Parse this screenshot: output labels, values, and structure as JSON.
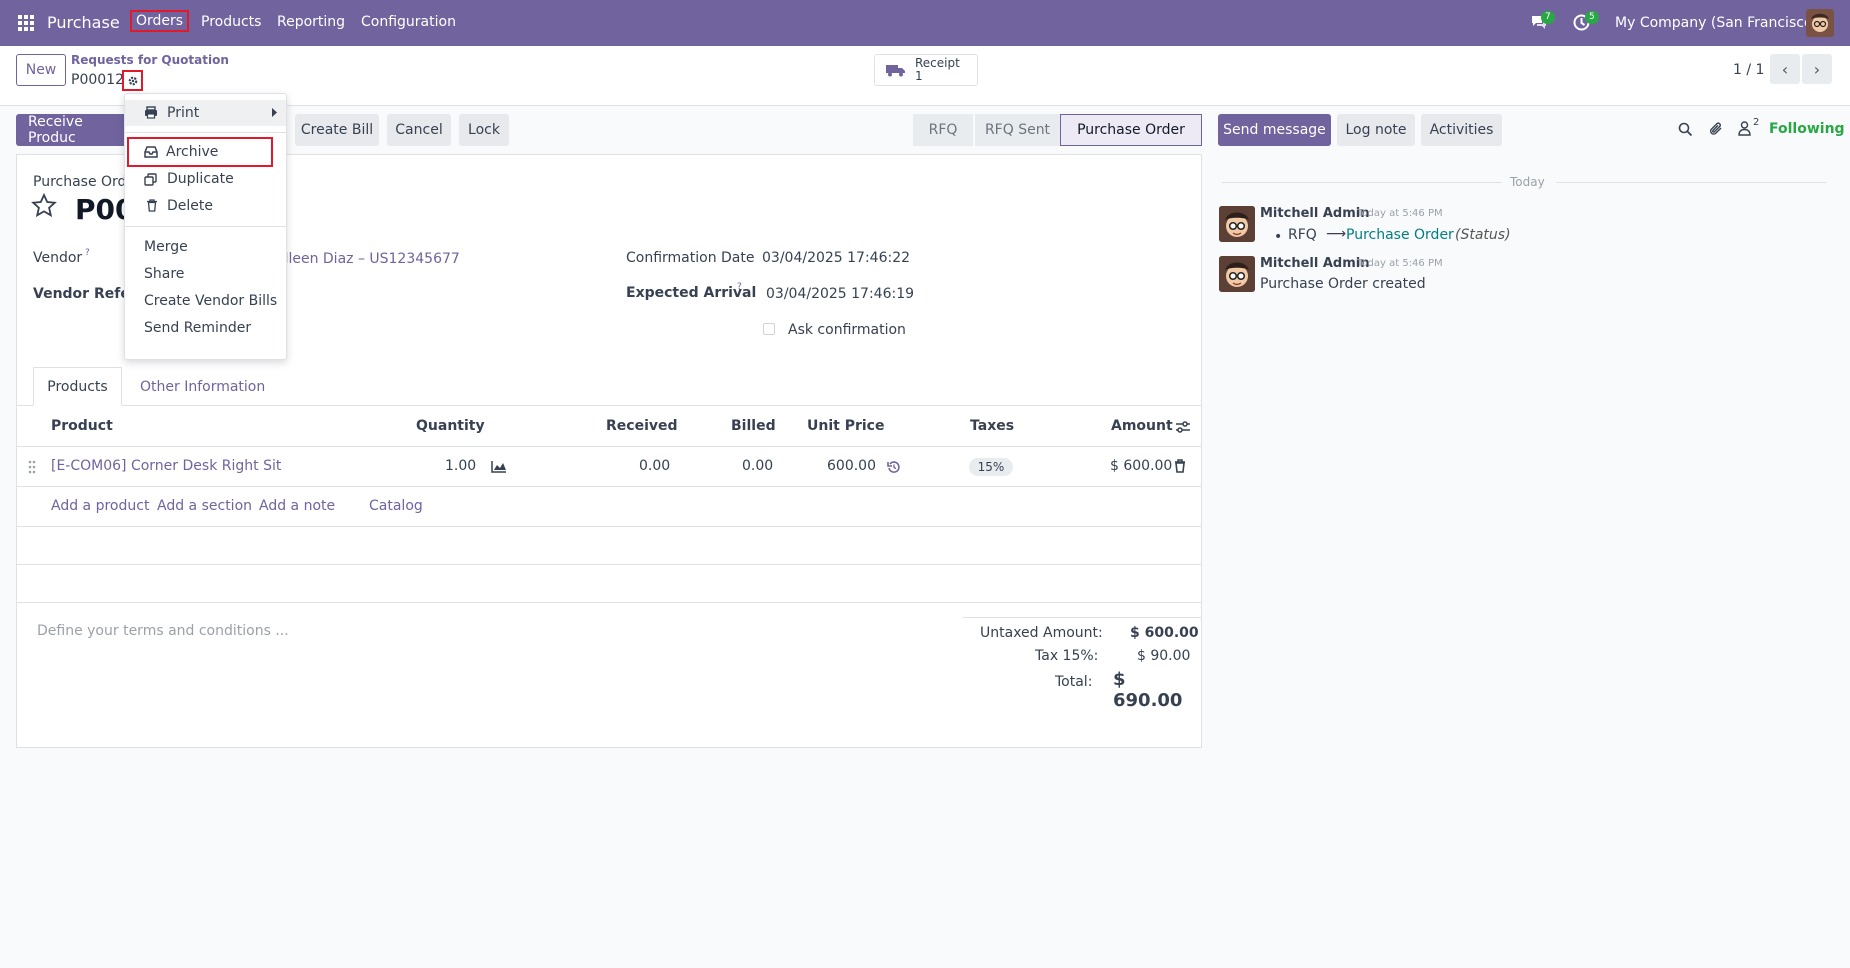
{
  "navbar": {
    "app_name": "Purchase",
    "menu": [
      "Orders",
      "Products",
      "Reporting",
      "Configuration"
    ],
    "messages_count": "7",
    "activities_count": "5",
    "company": "My Company (San Francisco)"
  },
  "control_panel": {
    "new_label": "New",
    "breadcrumb_parent": "Requests for Quotation",
    "breadcrumb_current": "P00012",
    "receipt_label": "Receipt",
    "receipt_count": "1",
    "pager": "1 / 1"
  },
  "actions": {
    "receive": "Receive Produc",
    "create_bill": "Create Bill",
    "cancel": "Cancel",
    "lock": "Lock"
  },
  "statusbar": [
    "RFQ",
    "RFQ Sent",
    "Purchase Order"
  ],
  "dropdown": {
    "print": "Print",
    "archive": "Archive",
    "duplicate": "Duplicate",
    "delete": "Delete",
    "merge": "Merge",
    "share": "Share",
    "create_vendor_bills": "Create Vendor Bills",
    "send_reminder": "Send Reminder"
  },
  "form": {
    "title_label": "Purchase Orde",
    "reference": "P00",
    "vendor_label": "Vendor",
    "vendor_value": "olleen Diaz – US12345677",
    "vendor_ref_label": "Vendor Refere",
    "help_mark": "?",
    "confirmation_date_label": "Confirmation Date",
    "confirmation_date": "03/04/2025 17:46:22",
    "expected_arrival_label": "Expected Arrival",
    "expected_arrival": "03/04/2025 17:46:19",
    "ask_confirmation": "Ask confirmation"
  },
  "tabs": [
    "Products",
    "Other Information"
  ],
  "table": {
    "headers": [
      "Product",
      "Quantity",
      "Received",
      "Billed",
      "Unit Price",
      "Taxes",
      "Amount"
    ],
    "rows": [
      {
        "product": "[E-COM06] Corner Desk Right Sit",
        "quantity": "1.00",
        "received": "0.00",
        "billed": "0.00",
        "unit_price": "600.00",
        "taxes": "15%",
        "amount": "$ 600.00"
      }
    ],
    "add_links": [
      "Add a product",
      "Add a section",
      "Add a note",
      "Catalog"
    ]
  },
  "terms_placeholder": "Define your terms and conditions ...",
  "totals": {
    "untaxed_label": "Untaxed Amount:",
    "untaxed_value": "$ 600.00",
    "tax_label": "Tax 15%:",
    "tax_value": "$ 90.00",
    "total_label": "Total:",
    "total_value": "$ 690.00"
  },
  "chatter": {
    "send_message": "Send message",
    "log_note": "Log note",
    "activities": "Activities",
    "followers_count": "2",
    "following": "Following",
    "today": "Today",
    "messages": [
      {
        "author": "Mitchell Admin",
        "time": "Today at 5:46 PM",
        "from": "RFQ",
        "to": "Purchase Order",
        "field": "(Status)"
      },
      {
        "author": "Mitchell Admin",
        "time": "Today at 5:46 PM",
        "body": "Purchase Order created"
      }
    ]
  },
  "colors": {
    "brand": "#71639e",
    "link": "#017e84",
    "highlight": "#e0192b",
    "success": "#28a745"
  }
}
